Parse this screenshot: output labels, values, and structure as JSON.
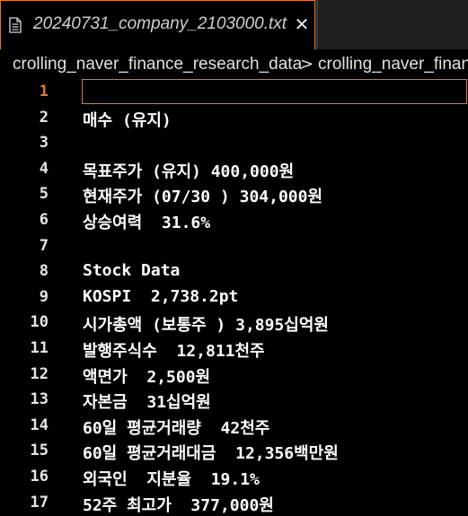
{
  "tab": {
    "title": "20240731_company_2103000.txt",
    "close_glyph": "✕",
    "icon": "file-text-icon"
  },
  "breadcrumb": {
    "items": [
      "crolling_naver_finance_research_data",
      "crolling_naver_finan"
    ],
    "separator": ">"
  },
  "editor": {
    "active_line": 1,
    "lines": [
      {
        "num": "1",
        "text": ""
      },
      {
        "num": "2",
        "text": "매수 (유지)"
      },
      {
        "num": "3",
        "text": ""
      },
      {
        "num": "4",
        "text": "목표주가 (유지) 400,000원"
      },
      {
        "num": "5",
        "text": "현재주가 (07/30 ) 304,000원"
      },
      {
        "num": "6",
        "text": "상승여력  31.6%"
      },
      {
        "num": "7",
        "text": ""
      },
      {
        "num": "8",
        "text": "Stock Data"
      },
      {
        "num": "9",
        "text": "KOSPI  2,738.2pt"
      },
      {
        "num": "10",
        "text": "시가총액 (보통주 ) 3,895십억원"
      },
      {
        "num": "11",
        "text": "발행주식수  12,811천주"
      },
      {
        "num": "12",
        "text": "액면가  2,500원"
      },
      {
        "num": "13",
        "text": "자본금  31십억원"
      },
      {
        "num": "14",
        "text": "60일 평균거래량  42천주"
      },
      {
        "num": "15",
        "text": "60일 평균거래대금  12,356백만원"
      },
      {
        "num": "16",
        "text": "외국인  지분율  19.1%"
      },
      {
        "num": "17",
        "text": "52주 최고가  377,000원"
      }
    ]
  },
  "colors": {
    "accent": "#e07b2f",
    "background": "#000000",
    "text": "#ffffff"
  }
}
